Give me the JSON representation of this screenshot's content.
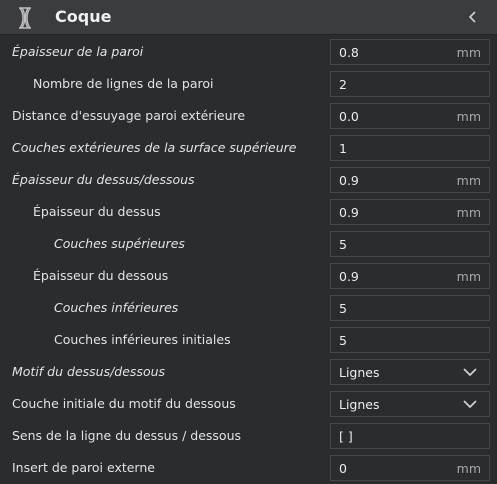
{
  "header": {
    "title": "Coque",
    "icon": "shell-icon",
    "collapse_icon": "chevron-left-icon"
  },
  "settings": [
    {
      "label": "Épaisseur de la paroi",
      "value": "0.8",
      "unit": "mm",
      "italic": true,
      "indent": 0,
      "type": "number"
    },
    {
      "label": "Nombre de lignes de la paroi",
      "value": "2",
      "unit": "",
      "italic": false,
      "indent": 1,
      "type": "number"
    },
    {
      "label": "Distance d'essuyage paroi extérieure",
      "value": "0.0",
      "unit": "mm",
      "italic": false,
      "indent": 0,
      "type": "number"
    },
    {
      "label": "Couches extérieures de la surface supérieure",
      "value": "1",
      "unit": "",
      "italic": true,
      "indent": 0,
      "type": "number"
    },
    {
      "label": "Épaisseur du dessus/dessous",
      "value": "0.9",
      "unit": "mm",
      "italic": true,
      "indent": 0,
      "type": "number"
    },
    {
      "label": "Épaisseur du dessus",
      "value": "0.9",
      "unit": "mm",
      "italic": false,
      "indent": 1,
      "type": "number"
    },
    {
      "label": "Couches supérieures",
      "value": "5",
      "unit": "",
      "italic": true,
      "indent": 2,
      "type": "number"
    },
    {
      "label": "Épaisseur du dessous",
      "value": "0.9",
      "unit": "mm",
      "italic": false,
      "indent": 1,
      "type": "number"
    },
    {
      "label": "Couches inférieures",
      "value": "5",
      "unit": "",
      "italic": true,
      "indent": 2,
      "type": "number"
    },
    {
      "label": "Couches inférieures initiales",
      "value": "5",
      "unit": "",
      "italic": false,
      "indent": 2,
      "type": "number"
    },
    {
      "label": "Motif du dessus/dessous",
      "value": "Lignes",
      "unit": "",
      "italic": true,
      "indent": 0,
      "type": "select"
    },
    {
      "label": "Couche initiale du motif du dessous",
      "value": "Lignes",
      "unit": "",
      "italic": false,
      "indent": 0,
      "type": "select"
    },
    {
      "label": "Sens de la ligne du dessus / dessous",
      "value": "[ ]",
      "unit": "",
      "italic": false,
      "indent": 0,
      "type": "text"
    },
    {
      "label": "Insert de paroi externe",
      "value": "0",
      "unit": "mm",
      "italic": false,
      "indent": 0,
      "type": "number"
    }
  ]
}
